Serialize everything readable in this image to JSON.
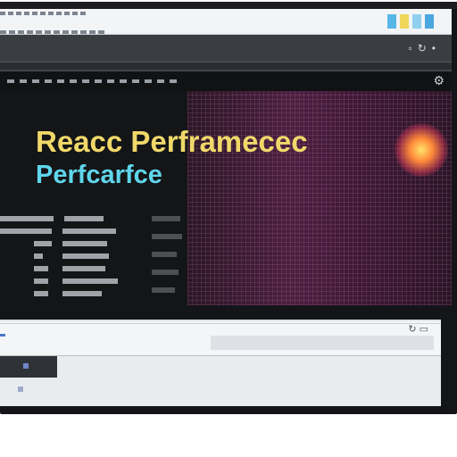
{
  "headline": "Reacc Perframecec",
  "subhead": "Perfcarfce",
  "topbar": {
    "colors": [
      "#56b7e6",
      "#f0d75a",
      "#8fd0ef",
      "#4aa7e0"
    ]
  },
  "icons": {
    "refresh": "refresh-icon",
    "settings": "gear-icon",
    "close": "close-icon"
  },
  "colors": {
    "headline": "#f0d86a",
    "subhead": "#5fd6ec",
    "graph_accent": "#4b2040",
    "glow": "#ffe46a"
  }
}
